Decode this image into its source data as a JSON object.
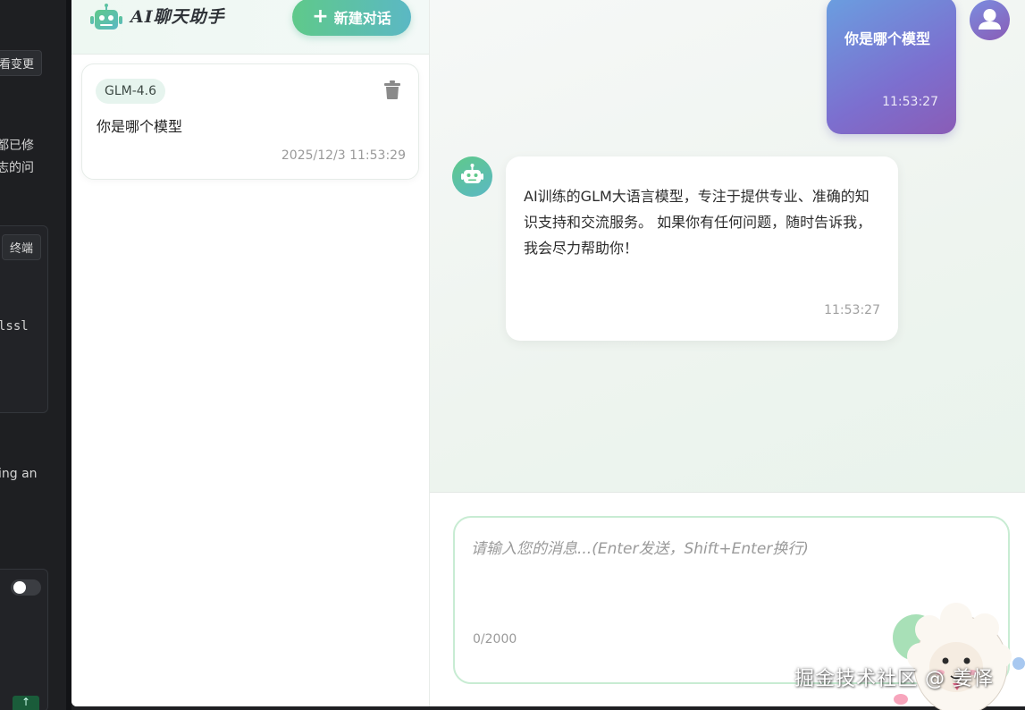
{
  "background_window": {
    "btn_changes": "看变更",
    "text_line1": "都已修",
    "text_line2": "志的问",
    "btn_terminal": "终端",
    "code_text": "lssl",
    "text_ing": "ing an",
    "btn_up": "↑"
  },
  "sidebar": {
    "app_title": "AI聊天助手",
    "new_chat_label": "新建对话",
    "conversations": [
      {
        "model": "GLM-4.6",
        "title": "你是哪个模型",
        "time": "2025/12/3 11:53:29"
      }
    ]
  },
  "chat": {
    "messages": [
      {
        "role": "user",
        "text": "你是哪个模型",
        "time": "11:53:27"
      },
      {
        "role": "assistant",
        "text": "AI训练的GLM大语言模型，专注于提供专业、准确的知识支持和交流服务。 如果你有任何问题，随时告诉我，我会尽力帮助你！",
        "time": "11:53:27"
      }
    ],
    "input": {
      "placeholder": "请输入您的消息...(Enter发送，Shift+Enter换行)",
      "value": "",
      "char_count": "0/2000"
    }
  },
  "watermark": "掘金技术社区 @ 姜怿",
  "colors": {
    "accent_green": "#5fc98a",
    "accent_teal": "#5bb8c4",
    "user_bubble_start": "#6a9fe0",
    "user_bubble_end": "#8a5cb6"
  },
  "icons": {
    "logo": "robot-icon",
    "new_chat": "plus-icon",
    "delete": "trash-icon",
    "user_avatar": "user-icon",
    "bot_avatar": "robot-icon",
    "send": "send-icon"
  }
}
